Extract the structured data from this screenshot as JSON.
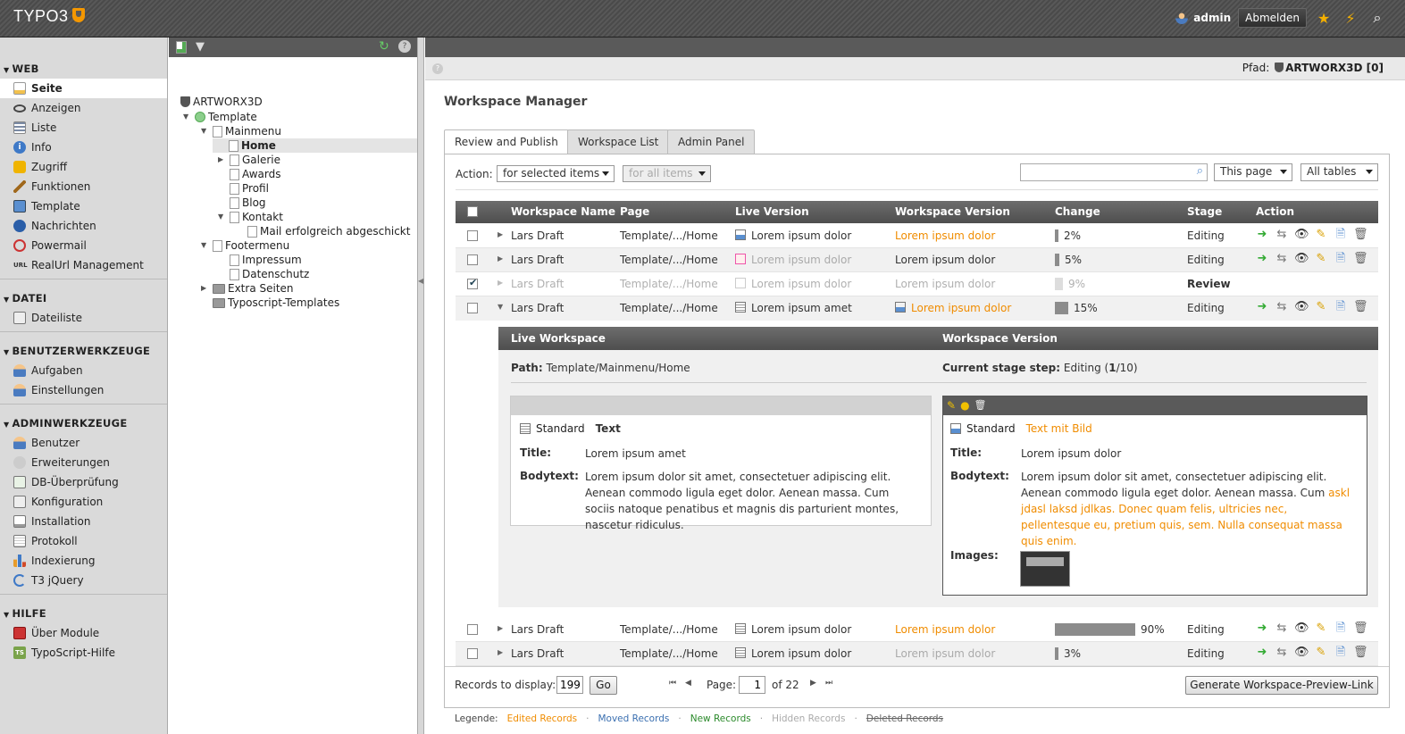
{
  "app": {
    "logo_text": "TYPO3"
  },
  "top": {
    "user": "admin",
    "logout": "Abmelden"
  },
  "modules": [
    {
      "group": "WEB",
      "items": [
        "Seite",
        "Anzeigen",
        "Liste",
        "Info",
        "Zugriff",
        "Funktionen",
        "Template",
        "Nachrichten",
        "Powermail",
        "RealUrl Management"
      ]
    },
    {
      "group": "DATEI",
      "items": [
        "Dateiliste"
      ]
    },
    {
      "group": "BENUTZERWERKZEUGE",
      "items": [
        "Aufgaben",
        "Einstellungen"
      ]
    },
    {
      "group": "ADMINWERKZEUGE",
      "items": [
        "Benutzer",
        "Erweiterungen",
        "DB-Überprüfung",
        "Konfiguration",
        "Installation",
        "Protokoll",
        "Indexierung",
        "T3 jQuery"
      ]
    },
    {
      "group": "HILFE",
      "items": [
        "Über Module",
        "TypoScript-Hilfe"
      ]
    }
  ],
  "tree": {
    "root": "ARTWORX3D",
    "nodes": [
      "Template",
      "Mainmenu",
      "Home",
      "Galerie",
      "Awards",
      "Profil",
      "Blog",
      "Kontakt",
      "Mail erfolgreich abgeschickt",
      "Footermenu",
      "Impressum",
      "Datenschutz",
      "Extra Seiten",
      "Typoscript-Templates"
    ]
  },
  "path": {
    "label": "Pfad:",
    "value": "ARTWORX3D [0]"
  },
  "page_title": "Workspace Manager",
  "tabs": [
    "Review and Publish",
    "Workspace List",
    "Admin Panel"
  ],
  "toolbar": {
    "action_label": "Action:",
    "selected_items": "for selected items",
    "all_items": "for all items",
    "search_placeholder": "",
    "page_scope": "This page",
    "table_scope": "All tables"
  },
  "columns": [
    "Workspace Name",
    "Page",
    "Live Version",
    "Workspace Version",
    "Change",
    "Stage",
    "Action"
  ],
  "rows": [
    {
      "name": "Lars Draft",
      "page": "Template/.../Home",
      "live": "Lorem ipsum dolor",
      "ws": "Lorem ipsum dolor",
      "change": 2,
      "change_label": "2%",
      "stage": "Editing"
    },
    {
      "name": "Lars Draft",
      "page": "Template/.../Home",
      "live": "Lorem ipsum dolor",
      "ws": "Lorem ipsum dolor",
      "change": 5,
      "change_label": "5%",
      "stage": "Editing"
    },
    {
      "name": "Lars Draft",
      "page": "Template/.../Home",
      "live": "Lorem ipsum dolor",
      "ws": "Lorem ipsum dolor",
      "change": 9,
      "change_label": "9%",
      "stage": "Review"
    },
    {
      "name": "Lars Draft",
      "page": "Template/.../Home",
      "live": "Lorem ipsum amet",
      "ws": "Lorem ipsum dolor",
      "change": 15,
      "change_label": "15%",
      "stage": "Editing"
    },
    {
      "name": "Lars Draft",
      "page": "Template/.../Home",
      "live": "Lorem ipsum dolor",
      "ws": "Lorem ipsum dolor",
      "change": 90,
      "change_label": "90%",
      "stage": "Editing"
    },
    {
      "name": "Lars Draft",
      "page": "Template/.../Home",
      "live": "Lorem ipsum dolor",
      "ws": "Lorem ipsum dolor",
      "change": 3,
      "change_label": "3%",
      "stage": "Editing"
    }
  ],
  "detail": {
    "live_header": "Live Workspace",
    "ws_header": "Workspace Version",
    "path_label": "Path:",
    "path_value": "Template/Mainmenu/Home",
    "stage_label": "Current stage step:",
    "stage_value_pre": "Editing (",
    "stage_value_num": "1",
    "stage_value_post": "/10)",
    "live": {
      "type": "Standard",
      "ctype": "Text",
      "title_label": "Title:",
      "title": "Lorem ipsum amet",
      "body_label": "Bodytext:",
      "body": "Lorem ipsum dolor sit amet, consectetuer adipiscing elit. Aenean commodo ligula eget dolor. Aenean massa. Cum sociis natoque penatibus et magnis dis parturient montes, nascetur ridiculus."
    },
    "ws": {
      "type": "Standard",
      "ctype": "Text mit Bild",
      "title_label": "Title:",
      "title": "Lorem ipsum dolor",
      "body_label": "Bodytext:",
      "body_plain": "Lorem ipsum dolor sit amet, consectetuer adipiscing elit. Aenean commodo ligula eget dolor. Aenean massa. Cum",
      "body_changed": "askl jdasl laksd jdlkas. Donec quam felis, ultricies nec, pellentesque eu, pretium quis, sem. Nulla consequat massa quis enim.",
      "images_label": "Images:"
    }
  },
  "pager": {
    "records_label": "Records to display:",
    "records_value": "199",
    "go": "Go",
    "page_label": "Page:",
    "page_value": "1",
    "of": "of 22",
    "preview_link": "Generate Workspace-Preview-Link"
  },
  "legend": {
    "label": "Legende:",
    "edited": "Edited Records",
    "moved": "Moved Records",
    "new": "New Records",
    "hidden": "Hidden Records",
    "deleted": "Deleted Records"
  },
  "colors": {
    "accent": "#f08c00",
    "moved": "#3a6fb0",
    "new": "#2b8a2b"
  }
}
